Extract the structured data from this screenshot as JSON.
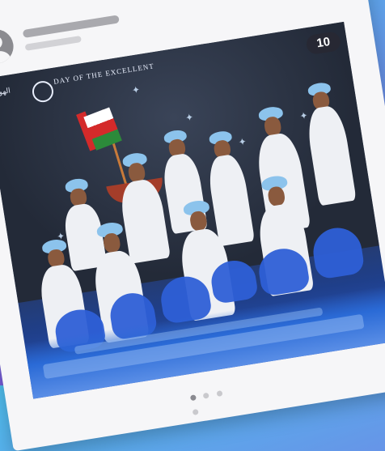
{
  "post": {
    "counter_badge": "10",
    "logo_text": "DAY OF THE EXCELLENT",
    "logo_subtext": "الهوية",
    "header_right_text": "",
    "carousel": {
      "total": 4,
      "active_index": 0
    }
  },
  "colors": {
    "background_gradient": [
      "#4fc0f0",
      "#7a5ad8",
      "#9b4fd0"
    ],
    "card": "#f6f6f8",
    "avatar": "#8b8b90",
    "badge_bg": "#28283a"
  },
  "icons": {
    "avatar": "user-avatar-icon",
    "sparkle": "star-sparkle-icon"
  }
}
